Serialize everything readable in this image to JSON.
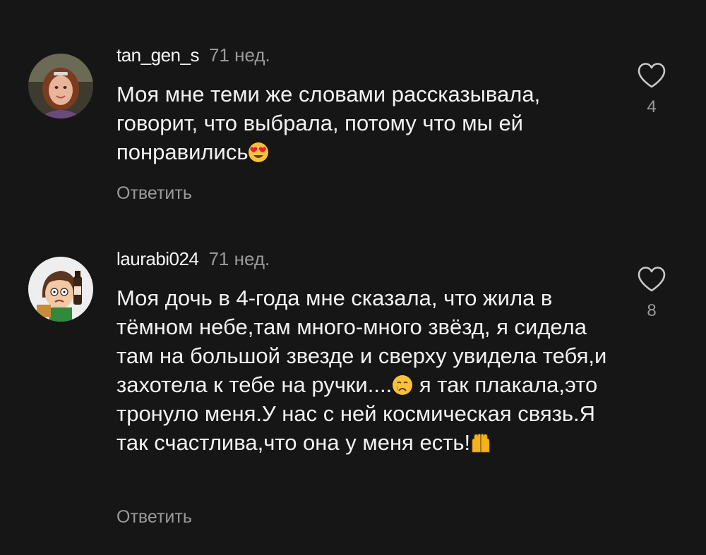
{
  "comments": [
    {
      "username": "tan_gen_s",
      "time": "71 нед.",
      "text": "Моя мне теми же словами рассказывала, говорит, что выбрала, потому что мы ей понравились",
      "emoji": "heart-eyes-emoji",
      "reply_label": "Ответить",
      "likes": "4",
      "like_icon": "heart-outline-icon"
    },
    {
      "username": "laurabi024",
      "time": "71 нед.",
      "text_part1": "Моя дочь в 4-года мне сказала, что жила в тёмном небе,там много-много звёзд, я сидела там на большой звезде и сверху увидела тебя,и захотела к тебе на ручки....",
      "emoji1": "crying-face-emoji",
      "text_part2": " я так плакала,это тронуло меня.У нас с ней космическая связь.Я так счастлива,что она у меня есть!",
      "emoji2": "raising-hands-emoji",
      "reply_label": "Ответить",
      "likes": "8",
      "like_icon": "heart-outline-icon"
    }
  ],
  "colors": {
    "background": "#161616",
    "text": "#f2f2f2",
    "secondary": "#9a9a9a"
  }
}
